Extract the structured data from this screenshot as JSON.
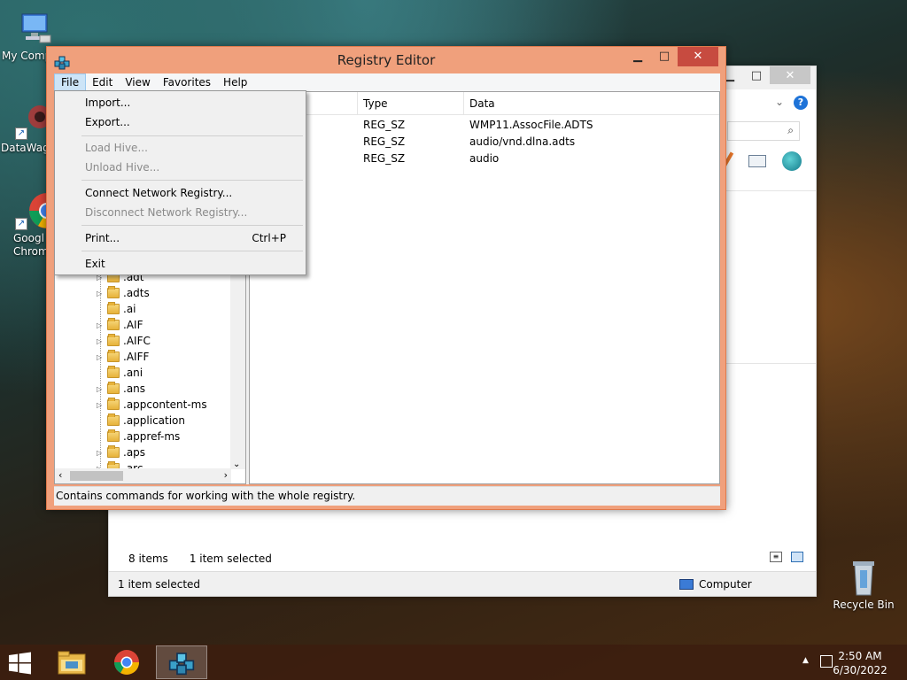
{
  "desktop": {
    "icons": [
      {
        "label": "My Comp"
      },
      {
        "label": "DataWag"
      },
      {
        "label": "Googl\nChrom"
      },
      {
        "label": "Recycle Bin"
      }
    ]
  },
  "explorer": {
    "status_items": "8 items",
    "status_selected": "1 item selected",
    "bottom_selected": "1 item selected",
    "bottom_location": "Computer"
  },
  "regedit": {
    "title": "Registry Editor",
    "menu": [
      "File",
      "Edit",
      "View",
      "Favorites",
      "Help"
    ],
    "columns": [
      "Type",
      "Data"
    ],
    "rows": [
      {
        "name": ")",
        "type": "REG_SZ",
        "data": "WMP11.AssocFile.ADTS"
      },
      {
        "name": "t Type",
        "type": "REG_SZ",
        "data": "audio/vnd.dlna.adts"
      },
      {
        "name": "edType",
        "type": "REG_SZ",
        "data": "audio"
      }
    ],
    "tree": [
      ".adt",
      ".adts",
      ".ai",
      ".AIF",
      ".AIFC",
      ".AIFF",
      ".ani",
      ".ans",
      ".appcontent-ms",
      ".application",
      ".appref-ms",
      ".aps",
      ".arc"
    ],
    "status": "Contains commands for working with the whole registry."
  },
  "file_menu": {
    "import": "Import...",
    "export": "Export...",
    "load_hive": "Load Hive...",
    "unload_hive": "Unload Hive...",
    "connect": "Connect Network Registry...",
    "disconnect": "Disconnect Network Registry...",
    "print": "Print...",
    "print_shortcut": "Ctrl+P",
    "exit": "Exit"
  },
  "taskbar": {
    "time": "2:50 AM",
    "date": "6/30/2022"
  },
  "colors": {
    "regedit_frame": "#f0a07c",
    "close_button": "#c74b40",
    "menu_highlight": "#cce4f7"
  }
}
